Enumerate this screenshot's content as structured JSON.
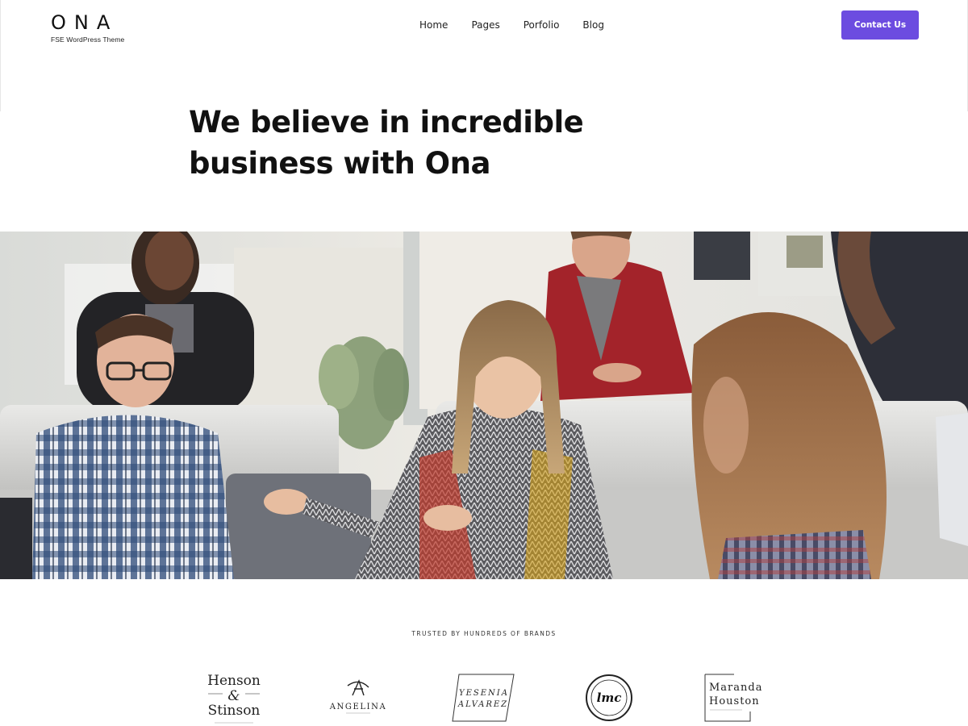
{
  "header": {
    "logo": "ONA",
    "tagline": "FSE WordPress Theme",
    "nav": [
      "Home",
      "Pages",
      "Porfolio",
      "Blog"
    ],
    "cta_label": "Contact Us",
    "cta_color": "#6c4ce0"
  },
  "hero": {
    "title_line1": "We believe in incredible",
    "title_line2": "business with Ona"
  },
  "brands_section": {
    "heading": "TRUSTED BY HUNDREDS OF BRANDS",
    "brands": [
      {
        "name_line1": "Henson",
        "amp": "&",
        "name_line2": "Stinson"
      },
      {
        "name": "ANGELINA"
      },
      {
        "name_line1": "YESENIA",
        "name_line2": "ALVAREZ"
      },
      {
        "monogram": "lmc"
      },
      {
        "name_line1": "Maranda",
        "name_line2": "Houston"
      }
    ]
  }
}
